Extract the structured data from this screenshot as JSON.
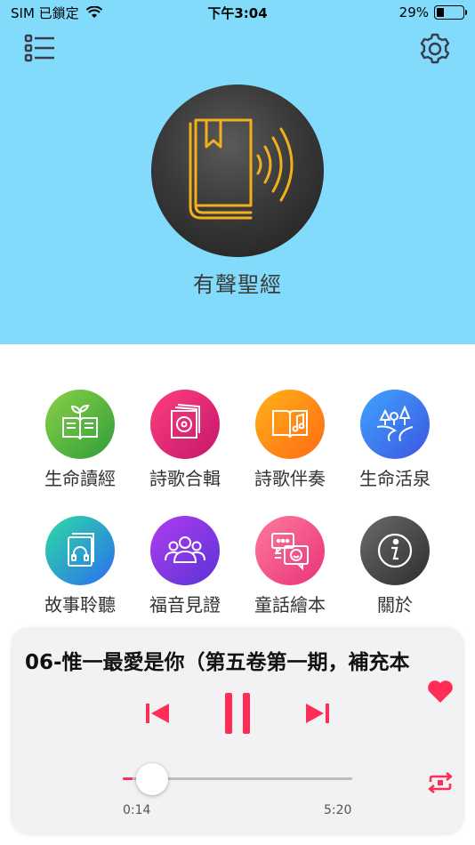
{
  "status": {
    "carrier": "SIM 已鎖定",
    "time": "下午3:04",
    "battery_text": "29%",
    "battery_level": 0.29
  },
  "header": {
    "title": "有聲聖經",
    "background": "#82dbfb",
    "menu_icon": "list-icon",
    "settings_icon": "gear-icon"
  },
  "grid": {
    "items": [
      {
        "label": "生命讀經",
        "icon": "sprout-book-icon",
        "colors": [
          "#8bd046",
          "#2e9e3a"
        ]
      },
      {
        "label": "詩歌合輯",
        "icon": "cd-stack-icon",
        "colors": [
          "#ff3f7e",
          "#c3166b"
        ]
      },
      {
        "label": "詩歌伴奏",
        "icon": "music-book-icon",
        "colors": [
          "#ffb21a",
          "#ff6a12"
        ]
      },
      {
        "label": "生命活泉",
        "icon": "trees-river-icon",
        "colors": [
          "#3fa4ff",
          "#3e55e0"
        ]
      },
      {
        "label": "故事聆聽",
        "icon": "headphone-book-icon",
        "colors": [
          "#2edba2",
          "#2b6ef0"
        ]
      },
      {
        "label": "福音見證",
        "icon": "people-group-icon",
        "colors": [
          "#b03cf0",
          "#5a33d6"
        ]
      },
      {
        "label": "童話繪本",
        "icon": "chat-bubbles-icon",
        "colors": [
          "#ff7a9a",
          "#e8337a"
        ]
      },
      {
        "label": "關於",
        "icon": "info-icon",
        "colors": [
          "#6a6a6a",
          "#2e2e2e"
        ]
      }
    ]
  },
  "player": {
    "title": "06-惟一最愛是你（第五卷第一期，補充本",
    "elapsed": "0:14",
    "total": "5:20",
    "progress": 0.044,
    "accent": "#ff2d55",
    "icons": {
      "favorite": "heart-icon",
      "previous": "skip-previous-icon",
      "pause": "pause-icon",
      "next": "skip-next-icon",
      "repeat": "repeat-icon"
    }
  }
}
